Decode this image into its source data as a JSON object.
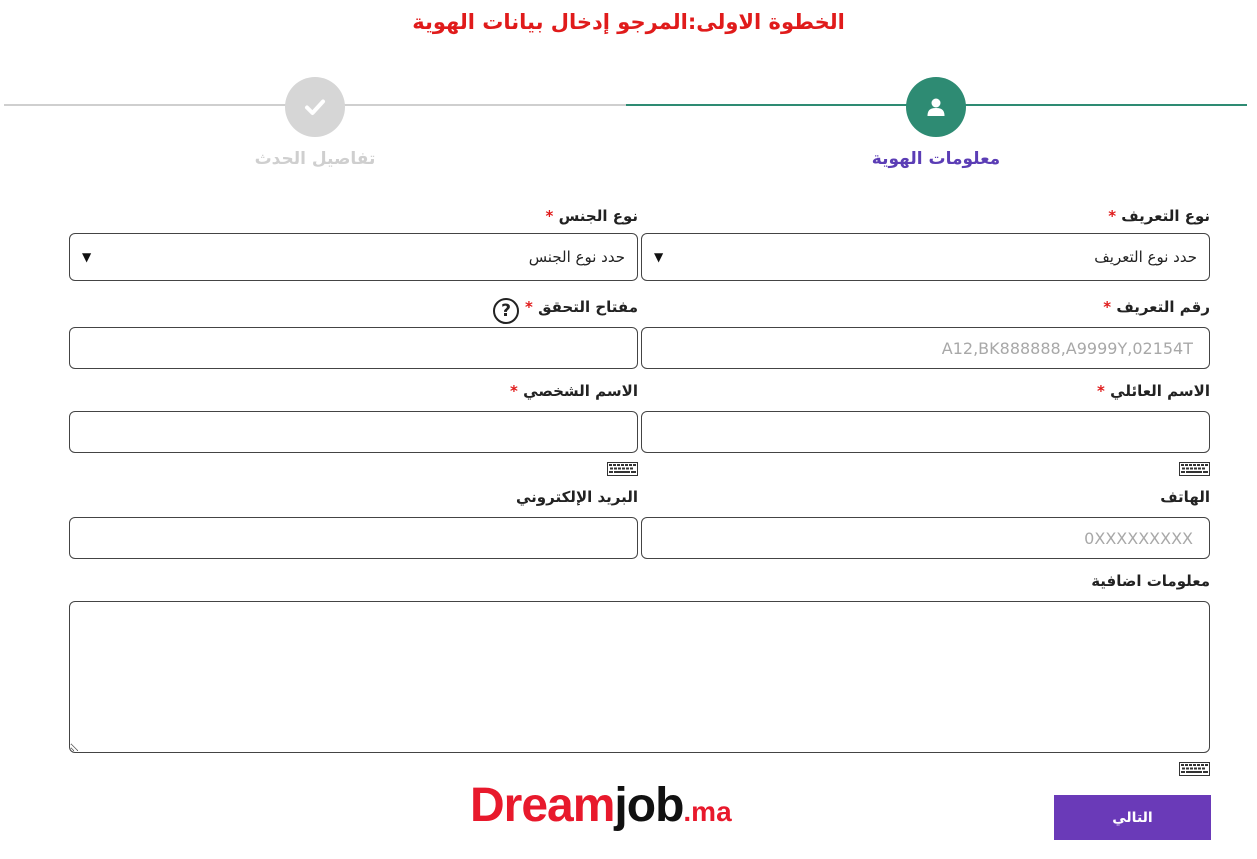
{
  "page": {
    "title": "الخطوة الاولى:المرجو إدخال بيانات الهوية"
  },
  "steps": [
    {
      "label": "معلومات الهوية",
      "state": "active"
    },
    {
      "label": "تفاصيل الحدث",
      "state": "done"
    }
  ],
  "form": {
    "required_mark": "*",
    "id_type": {
      "label": "نوع التعريف",
      "placeholder": "حدد نوع التعريف"
    },
    "gender": {
      "label": "نوع الجنس",
      "placeholder": "حدد نوع الجنس"
    },
    "id_number": {
      "label": "رقم التعريف",
      "placeholder": "A12,BK888888,A9999Y,02154T"
    },
    "verification_key": {
      "label": "مفتاح التحقق",
      "help": "?"
    },
    "last_name": {
      "label": "الاسم العائلي"
    },
    "first_name": {
      "label": "الاسم الشخصي"
    },
    "phone": {
      "label": "الهاتف",
      "placeholder": "0XXXXXXXXX"
    },
    "email": {
      "label": "البريد الإلكتروني"
    },
    "extra_info": {
      "label": "معلومات اضافية"
    }
  },
  "buttons": {
    "next": "التالي"
  },
  "logo": {
    "dream": "Dream",
    "job": "job",
    "ma": ".ma"
  },
  "colors": {
    "accent_green": "#2e8b73",
    "accent_purple": "#6a3ab8",
    "title_red": "#e01b1b",
    "inactive_gray": "#d6d6d6"
  }
}
